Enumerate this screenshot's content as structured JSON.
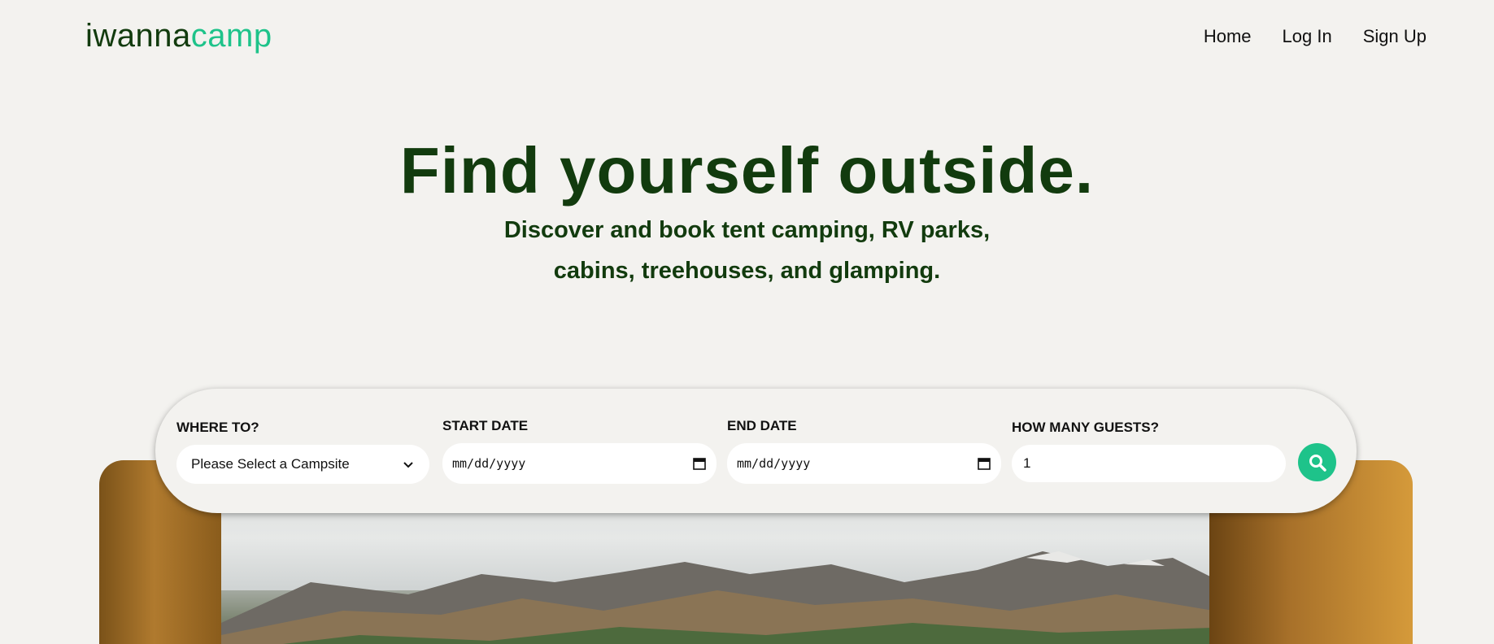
{
  "header": {
    "logo_part1": "iwanna",
    "logo_part2": "camp",
    "nav": [
      "Home",
      "Log In",
      "Sign Up"
    ]
  },
  "hero": {
    "title": "Find yourself outside.",
    "subtitle_line1": "Discover and book tent camping, RV parks,",
    "subtitle_line2": "cabins, treehouses, and glamping."
  },
  "search": {
    "where_label": "WHERE TO?",
    "where_value": "Please Select a Campsite",
    "start_label": "START DATE",
    "start_value": "mm/dd/yyyy",
    "end_label": "END DATE",
    "end_value": "mm/dd/yyyy",
    "guests_label": "HOW MANY GUESTS?",
    "guests_value": "1",
    "search_icon": "search-icon"
  },
  "colors": {
    "brand_dark": "#123b0e",
    "brand_accent": "#1ec38a",
    "background": "#f3f2ef"
  }
}
